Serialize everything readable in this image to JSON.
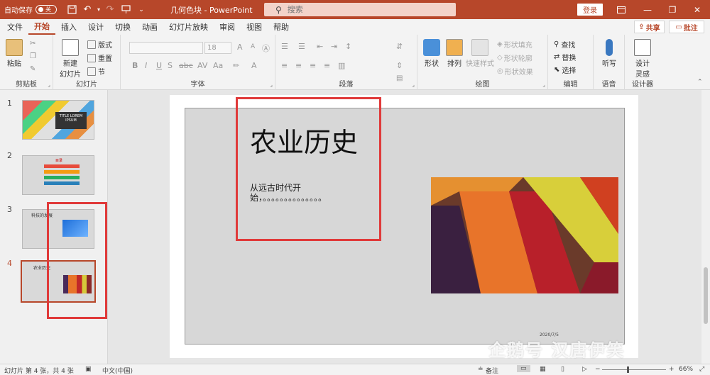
{
  "titlebar": {
    "autosave_label": "自动保存",
    "autosave_state": "关",
    "doc_title": "几何色块  -  PowerPoint",
    "search_placeholder": "搜索",
    "login_label": "登录"
  },
  "menu": {
    "tabs": [
      "文件",
      "开始",
      "插入",
      "设计",
      "切换",
      "动画",
      "幻灯片放映",
      "审阅",
      "视图",
      "帮助"
    ],
    "active": "开始",
    "share_label": "共享",
    "comment_label": "批注"
  },
  "ribbon": {
    "clipboard": {
      "label": "剪贴板",
      "paste": "粘贴"
    },
    "slides": {
      "label": "幻灯片",
      "new_slide": "新建",
      "new_slide2": "幻灯片",
      "layout": "版式",
      "reset": "重置",
      "section": "节"
    },
    "font": {
      "label": "字体",
      "size": "18"
    },
    "paragraph": {
      "label": "段落"
    },
    "drawing": {
      "label": "绘图",
      "shapes": "形状",
      "arrange": "排列",
      "quick_styles": "快速样式",
      "fill": "形状填充",
      "outline": "形状轮廓",
      "effects": "形状效果"
    },
    "editing": {
      "label": "编辑",
      "find": "查找",
      "replace": "替换",
      "select": "选择"
    },
    "voice": {
      "label": "语音",
      "dictate": "听写"
    },
    "designer": {
      "label": "设计器",
      "design_ideas": "设计",
      "design_ideas2": "灵感"
    }
  },
  "slides_panel": {
    "items": [
      {
        "number": "1",
        "title": "TITLE LOREM IPSUM"
      },
      {
        "number": "2",
        "title": "目录"
      },
      {
        "number": "3",
        "title": "科技的发展"
      },
      {
        "number": "4",
        "title": "农业历史"
      }
    ],
    "current": "4"
  },
  "slide": {
    "title": "农业历史",
    "body": "从远古时代开始，。。。。。。。。。。。。。。",
    "date": "2020/7/5"
  },
  "statusbar": {
    "slide_info": "幻灯片 第 4 张，共 4 张",
    "language": "中文(中国)",
    "notes": "备注",
    "zoom": "66%"
  },
  "watermark": "企鹅号 汉唐伊笑",
  "colors": {
    "accent": "#b7472a",
    "highlight": "#e03a3a"
  }
}
